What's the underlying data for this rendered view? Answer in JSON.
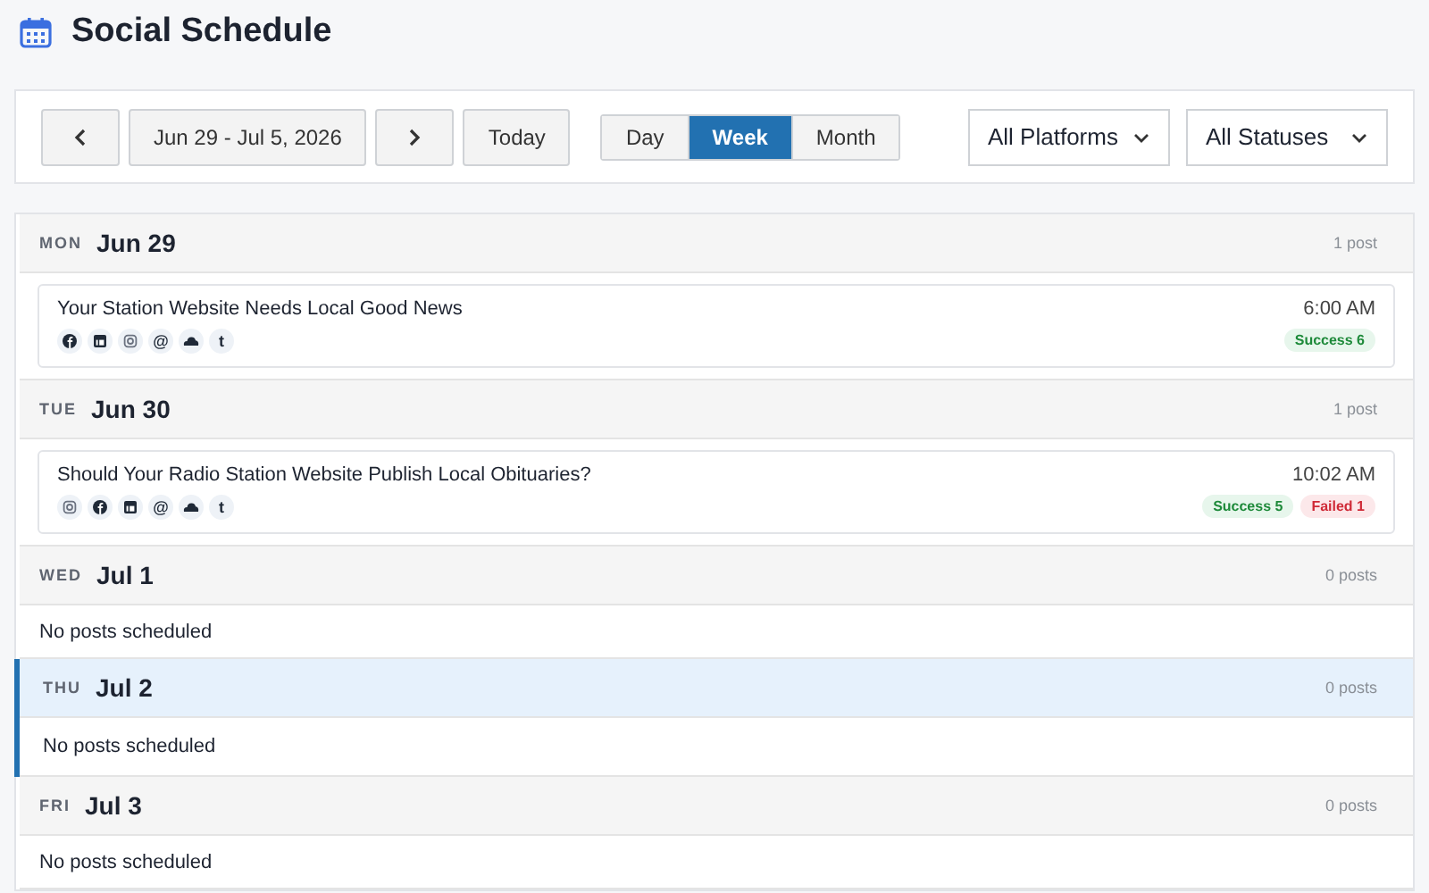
{
  "title": "Social Schedule",
  "toolbar": {
    "range": "Jun 29 - Jul 5, 2026",
    "today": "Today",
    "views": [
      {
        "label": "Day",
        "selected": false
      },
      {
        "label": "Week",
        "selected": true
      },
      {
        "label": "Month",
        "selected": false
      }
    ],
    "filters": [
      {
        "value": "All Platforms"
      },
      {
        "value": "All Statuses"
      }
    ]
  },
  "days": [
    {
      "weekday": "MON",
      "date": "Jun 29",
      "count": "1 post",
      "today": false,
      "posts": [
        {
          "title": "Your Station Website Needs Local Good News",
          "time": "6:00 AM",
          "platforms": [
            {
              "kind": "facebook"
            },
            {
              "kind": "linkedin"
            },
            {
              "kind": "instagram"
            },
            {
              "kind": "threads",
              "glyph": "@"
            },
            {
              "kind": "bluesky"
            },
            {
              "kind": "tumblr",
              "glyph": "t"
            }
          ],
          "statuses": [
            {
              "kind": "success",
              "label": "Success 6"
            }
          ]
        }
      ]
    },
    {
      "weekday": "TUE",
      "date": "Jun 30",
      "count": "1 post",
      "today": false,
      "posts": [
        {
          "title": "Should Your Radio Station Website Publish Local Obituaries?",
          "time": "10:02 AM",
          "platforms": [
            {
              "kind": "instagram"
            },
            {
              "kind": "facebook"
            },
            {
              "kind": "linkedin"
            },
            {
              "kind": "threads",
              "glyph": "@"
            },
            {
              "kind": "bluesky"
            },
            {
              "kind": "tumblr",
              "glyph": "t"
            }
          ],
          "statuses": [
            {
              "kind": "success",
              "label": "Success 5"
            },
            {
              "kind": "failed",
              "label": "Failed 1"
            }
          ]
        }
      ]
    },
    {
      "weekday": "WED",
      "date": "Jul 1",
      "count": "0 posts",
      "today": false,
      "empty": "No posts scheduled"
    },
    {
      "weekday": "THU",
      "date": "Jul 2",
      "count": "0 posts",
      "today": true,
      "empty": "No posts scheduled"
    },
    {
      "weekday": "FRI",
      "date": "Jul 3",
      "count": "0 posts",
      "today": false,
      "empty": "No posts scheduled"
    }
  ]
}
